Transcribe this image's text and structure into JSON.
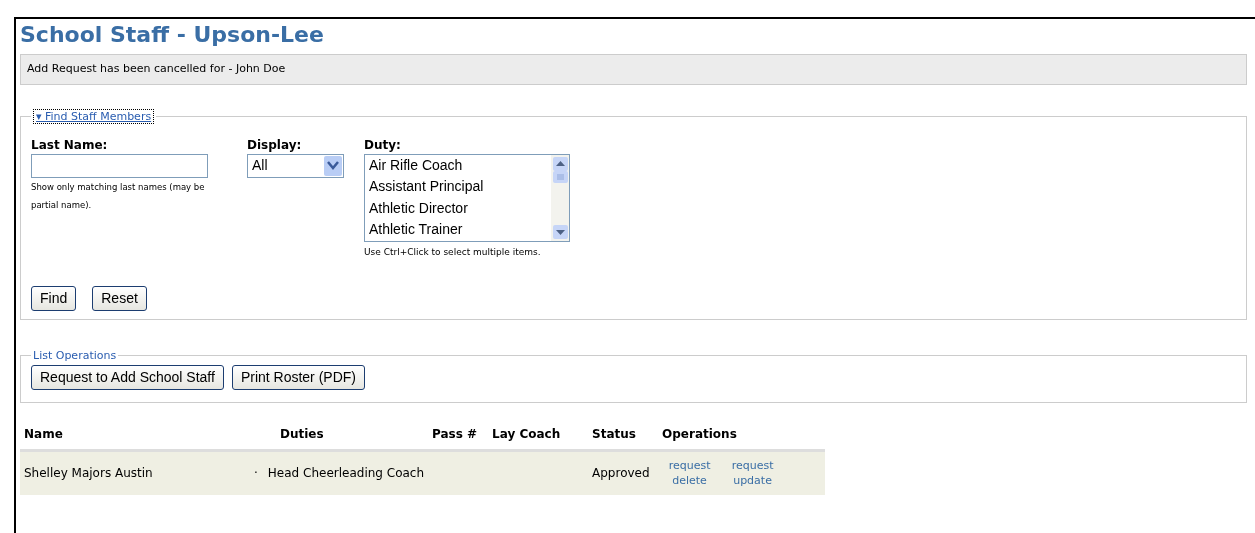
{
  "title": "School Staff - Upson-Lee",
  "message": "Add Request has been cancelled for - John Doe",
  "find_panel": {
    "toggle": "▾",
    "legend": "Find Staff Members",
    "last_name": {
      "label": "Last Name:",
      "hint": "Show only matching last names (may be partial name)."
    },
    "display": {
      "label": "Display:",
      "value": "All"
    },
    "duty": {
      "label": "Duty:",
      "options": [
        {
          "label": "Air Rifle Coach",
          "selected": false
        },
        {
          "label": "Assistant Principal",
          "selected": false
        },
        {
          "label": "Athletic Director",
          "selected": false
        },
        {
          "label": "Athletic Trainer",
          "selected": false
        }
      ],
      "hint": "Use Ctrl+Click to select multiple items."
    },
    "buttons": [
      "Find",
      "Reset"
    ]
  },
  "list_operations": {
    "legend": "List Operations",
    "buttons": [
      "Request to Add School Staff",
      "Print Roster (PDF)"
    ]
  },
  "table": {
    "columns": [
      "Name",
      "Duties",
      "Pass #",
      "Lay Coach",
      "Status",
      "Operations"
    ],
    "rows": [
      {
        "name": "Shelley Majors Austin",
        "duties": [
          {
            "bullet": "·",
            "label": "Head Cheerleading Coach"
          }
        ],
        "status": "Approved",
        "operations": [
          "request delete",
          "request update"
        ]
      }
    ]
  }
}
